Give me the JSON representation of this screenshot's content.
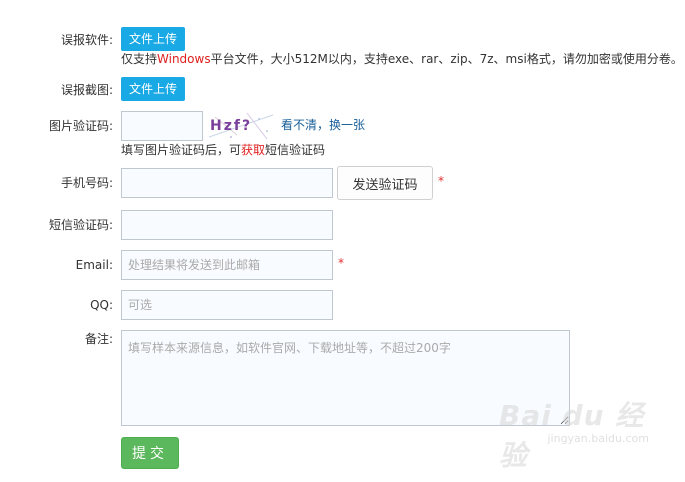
{
  "form": {
    "software": {
      "label": "误报软件:",
      "button": "文件上传",
      "hint_prefix": "仅支持",
      "hint_highlight": "Windows",
      "hint_suffix": "平台文件，大小512M以内，支持exe、rar、zip、7z、msi格式，请勿加密或使用分卷。"
    },
    "screenshot": {
      "label": "误报截图:",
      "button": "文件上传"
    },
    "captcha": {
      "label": "图片验证码:",
      "value": "",
      "image_text": "Hzf?",
      "refresh_link": "看不清，换一张",
      "hint_prefix": "填写图片验证码后，可",
      "hint_highlight": "获取",
      "hint_suffix": "短信验证码"
    },
    "phone": {
      "label": "手机号码:",
      "value": "",
      "send_button": "发送验证码",
      "required_mark": "*"
    },
    "sms": {
      "label": "短信验证码:",
      "value": ""
    },
    "email": {
      "label": "Email:",
      "placeholder": "处理结果将发送到此邮箱",
      "required_mark": "*"
    },
    "qq": {
      "label": "QQ:",
      "placeholder": "可选"
    },
    "notes": {
      "label": "备注:",
      "placeholder": "填写样本来源信息，如软件官网、下载地址等，不超过200字"
    },
    "submit": "提交"
  },
  "watermark": {
    "brand": "Bai du 经验",
    "url": "jingyan.baidu.com"
  },
  "colors": {
    "upload_button": "#19a9e5",
    "submit_button": "#5cb85c",
    "highlight": "#e02020",
    "link": "#1a5f99",
    "input_border": "#bfc7d1"
  }
}
